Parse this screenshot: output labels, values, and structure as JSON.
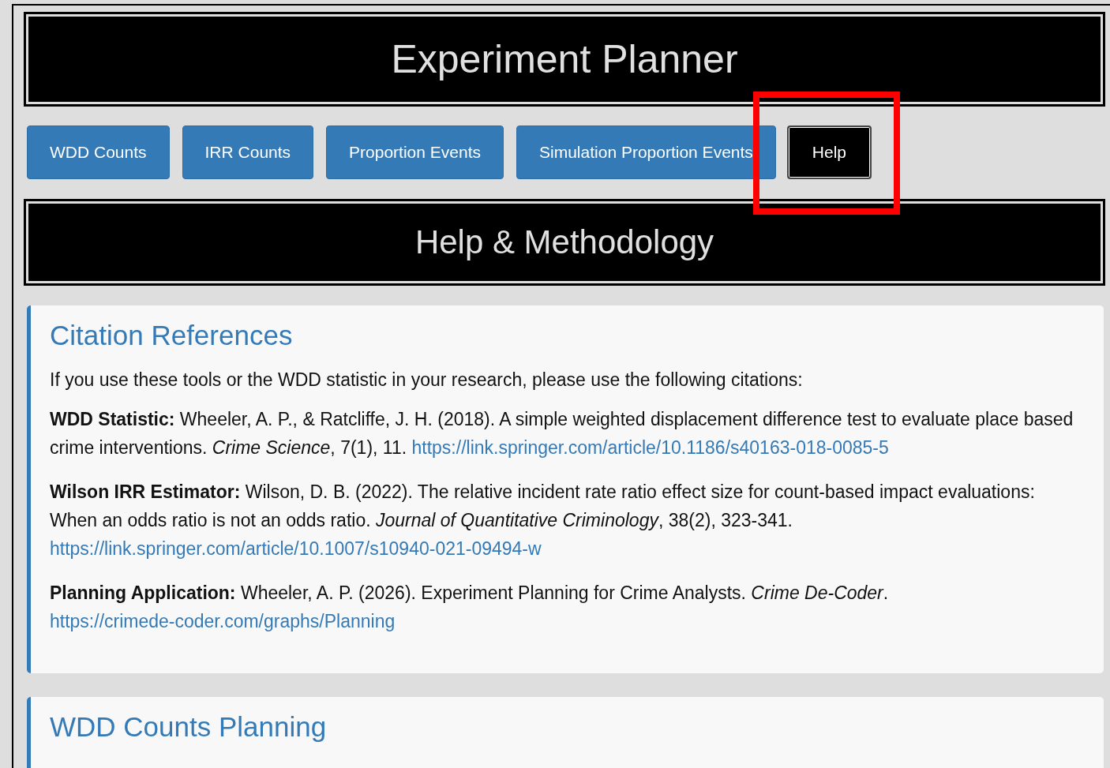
{
  "header": {
    "title": "Experiment Planner"
  },
  "tabs": [
    {
      "label": "WDD Counts",
      "selected": false
    },
    {
      "label": "IRR Counts",
      "selected": false
    },
    {
      "label": "Proportion Events",
      "selected": false
    },
    {
      "label": "Simulation Proportion Events",
      "selected": false
    },
    {
      "label": "Help",
      "selected": true,
      "highlighted": true
    }
  ],
  "section_header": {
    "title": "Help & Methodology"
  },
  "cards": [
    {
      "title": "Citation References",
      "intro": "If you use these tools or the WDD statistic in your research, please use the following citations:",
      "citations": [
        {
          "text": "**WDD Statistic:** Wheeler, A. P., & Ratcliffe, J. H. (2018). A simple weighted displacement difference test to evaluate place based crime interventions. *Crime Science*, 7(1), 11.",
          "link": "https://link.springer.com/article/10.1186/s40163-018-0085-5"
        },
        {
          "text": "**Wilson IRR Estimator:** Wilson, D. B. (2022). The relative incident rate ratio effect size for count-based impact evaluations: When an odds ratio is not an odds ratio. *Journal of Quantitative Criminology*, 38(2), 323-341.",
          "link": "https://link.springer.com/article/10.1007/s10940-021-09494-w"
        },
        {
          "text": "**Planning Application:** Wheeler, A. P. (2026). Experiment Planning for Crime Analysts. *Crime De-Coder*.",
          "link": "https://crimede-coder.com/graphs/Planning"
        }
      ]
    },
    {
      "title": "WDD Counts Planning"
    }
  ]
}
